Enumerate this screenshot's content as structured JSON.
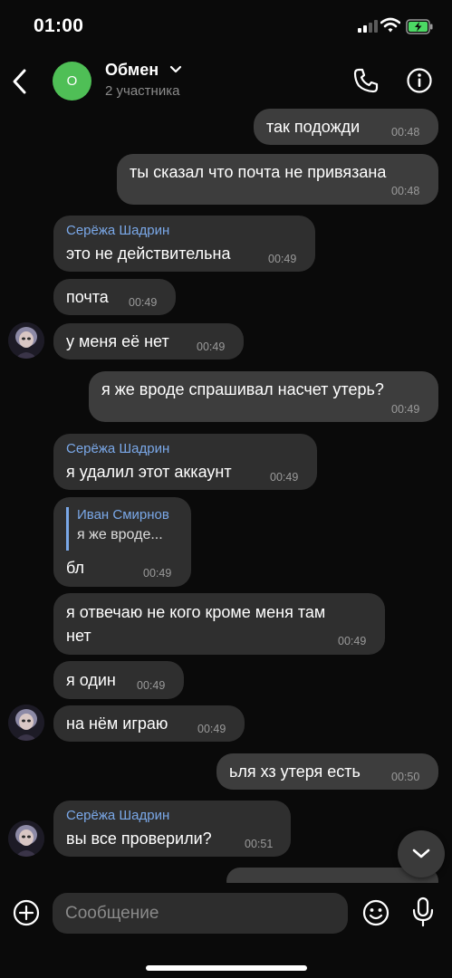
{
  "status_bar": {
    "time": "01:00"
  },
  "header": {
    "avatar_letter": "О",
    "title": "Обмен",
    "subtitle": "2 участника"
  },
  "messages": [
    {
      "id": "m1",
      "direction": "out",
      "text": "так подожди",
      "time": "00:48"
    },
    {
      "id": "m2",
      "direction": "out",
      "text": "ты сказал что почта не привязана",
      "time": "00:48"
    },
    {
      "id": "m3",
      "direction": "in",
      "sender": "Серёжа Шадрин",
      "text": "это не действительна",
      "time": "00:49"
    },
    {
      "id": "m4",
      "direction": "in",
      "text": "почта",
      "time": "00:49"
    },
    {
      "id": "m5",
      "direction": "in",
      "text": "у меня её нет",
      "time": "00:49",
      "avatar": true
    },
    {
      "id": "m6",
      "direction": "out",
      "text": "я же вроде спрашивал насчет утерь?",
      "time": "00:49"
    },
    {
      "id": "m7",
      "direction": "in",
      "sender": "Серёжа Шадрин",
      "text": "я удалил этот аккаунт",
      "time": "00:49"
    },
    {
      "id": "m8",
      "direction": "in",
      "reply_to": {
        "name": "Иван Смирнов",
        "text": "я же вроде..."
      },
      "text": "бл",
      "time": "00:49"
    },
    {
      "id": "m9",
      "direction": "in",
      "text_lines": [
        "я отвечаю не кого кроме меня там",
        "нет"
      ],
      "time": "00:49"
    },
    {
      "id": "m10",
      "direction": "in",
      "text": "я один",
      "time": "00:49"
    },
    {
      "id": "m11",
      "direction": "in",
      "text": "на нём играю",
      "time": "00:49",
      "avatar": true
    },
    {
      "id": "m12",
      "direction": "out",
      "text": "ьля хз утеря есть",
      "time": "00:50"
    },
    {
      "id": "m13",
      "direction": "in",
      "sender": "Серёжа Шадрин",
      "text": "вы все проверили?",
      "time": "00:51",
      "avatar": true
    }
  ],
  "composer": {
    "placeholder": "Сообщение"
  },
  "colors": {
    "accent": "#4fbf56",
    "sender": "#7aa8e8",
    "bubble_in": "#2f2f2f",
    "bubble_out": "#3d3d3d",
    "background": "#0a0a0a"
  },
  "icons": [
    "back-chevron-icon",
    "chevron-down-icon",
    "phone-icon",
    "info-icon",
    "plus-icon",
    "emoji-icon",
    "microphone-icon",
    "scroll-down-icon"
  ]
}
